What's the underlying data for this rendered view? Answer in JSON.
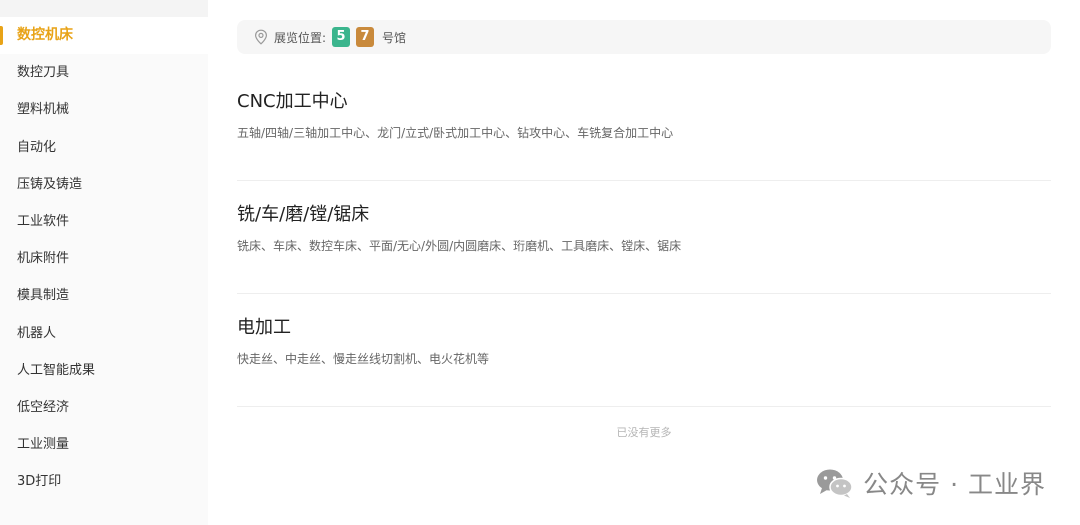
{
  "sidebar": {
    "items": [
      {
        "label": "数控机床",
        "active": true
      },
      {
        "label": "数控刀具",
        "active": false
      },
      {
        "label": "塑料机械",
        "active": false
      },
      {
        "label": "自动化",
        "active": false
      },
      {
        "label": "压铸及铸造",
        "active": false
      },
      {
        "label": "工业软件",
        "active": false
      },
      {
        "label": "机床附件",
        "active": false
      },
      {
        "label": "模具制造",
        "active": false
      },
      {
        "label": "机器人",
        "active": false
      },
      {
        "label": "人工智能成果",
        "active": false
      },
      {
        "label": "低空经济",
        "active": false
      },
      {
        "label": "工业测量",
        "active": false
      },
      {
        "label": "3D打印",
        "active": false
      }
    ],
    "accent_color": "#e8a317"
  },
  "location": {
    "icon": "location-pin-icon",
    "label": "展览位置:",
    "halls": [
      {
        "number": "5",
        "color": "#3bb58d"
      },
      {
        "number": "7",
        "color": "#c98a3c"
      }
    ],
    "suffix": "号馆"
  },
  "categories": [
    {
      "title": "CNC加工中心",
      "desc": "五轴/四轴/三轴加工中心、龙门/立式/卧式加工中心、钻攻中心、车铣复合加工中心"
    },
    {
      "title": "铣/车/磨/镗/锯床",
      "desc": "铣床、车床、数控车床、平面/无心/外圆/内圆磨床、珩磨机、工具磨床、镗床、锯床"
    },
    {
      "title": "电加工",
      "desc": "快走丝、中走丝、慢走丝线切割机、电火花机等"
    }
  ],
  "no_more_text": "已没有更多",
  "watermark": {
    "icon": "wechat-icon",
    "text": "公众号 · 工业界"
  }
}
